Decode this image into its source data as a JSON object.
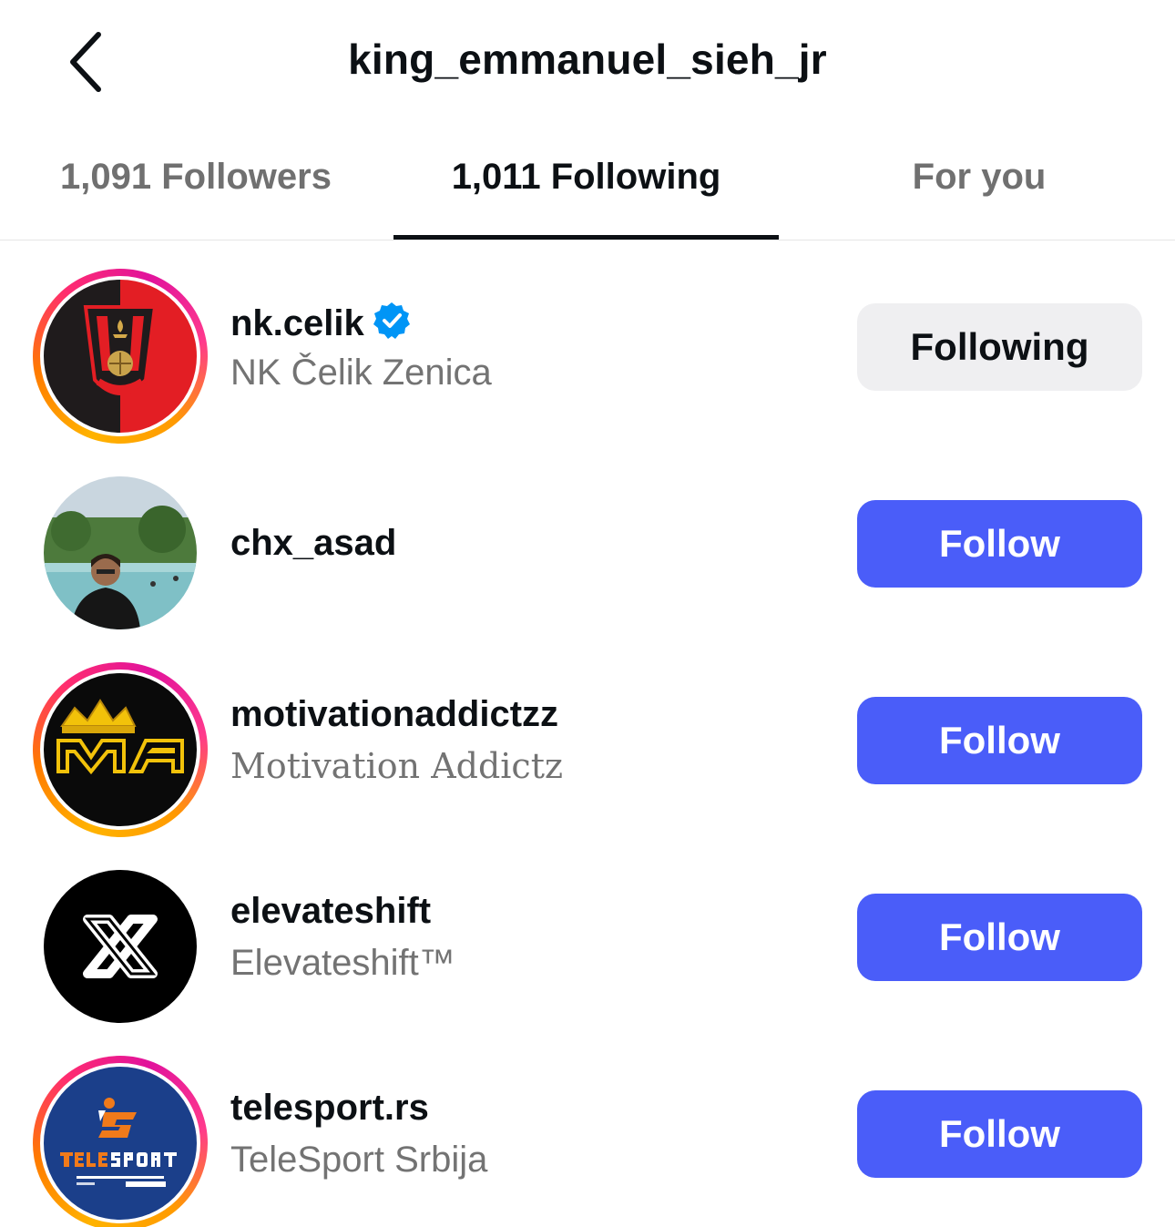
{
  "header": {
    "title": "king_emmanuel_sieh_jr",
    "back_icon": "chevron-left-icon"
  },
  "tabs": [
    {
      "label": "1,091 Followers",
      "active": false
    },
    {
      "label": "1,011 Following",
      "active": true
    },
    {
      "label": "For you",
      "active": false
    }
  ],
  "accounts": [
    {
      "username": "nk.celik",
      "full_name": "NK Čelik Zenica",
      "verified": true,
      "story_ring": true,
      "button": "Following",
      "avatar": "nk-celik-logo"
    },
    {
      "username": "chx_asad",
      "full_name": "",
      "verified": false,
      "story_ring": false,
      "button": "Follow",
      "avatar": "person-photo"
    },
    {
      "username": "motivationaddictzz",
      "full_name": "Motivation Addictz",
      "verified": false,
      "story_ring": true,
      "button": "Follow",
      "avatar": "crown-ma-logo"
    },
    {
      "username": "elevateshift",
      "full_name": "Elevateshift™",
      "verified": false,
      "story_ring": false,
      "button": "Follow",
      "avatar": "x-logo"
    },
    {
      "username": "telesport.rs",
      "full_name": "TeleSport Srbija",
      "verified": false,
      "story_ring": true,
      "button": "Follow",
      "avatar": "telesport-logo"
    }
  ],
  "colors": {
    "follow_button": "#4a5df9",
    "following_button": "#efeff1",
    "verified_badge": "#0095f6"
  }
}
